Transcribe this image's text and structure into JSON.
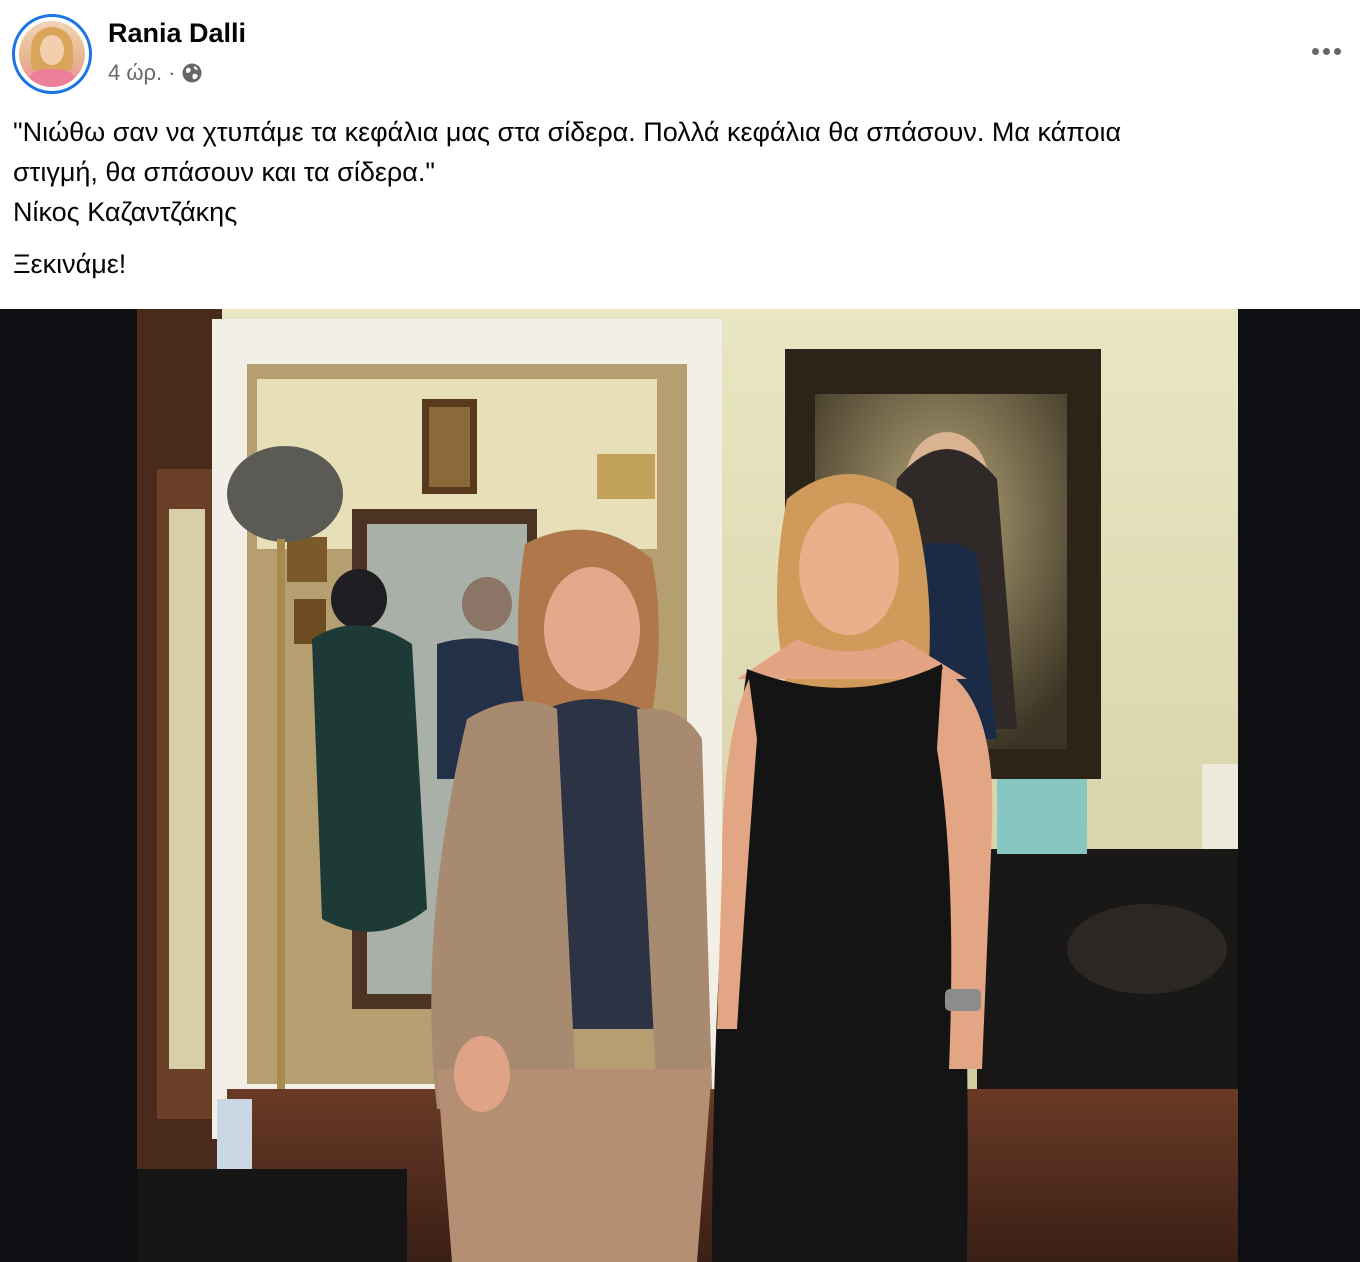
{
  "post": {
    "author": "Rania Dalli",
    "time": "4 ώρ.",
    "separator": "·",
    "privacy_icon": "globe-icon",
    "more_icon": "more-options-icon",
    "text_lines": [
      "\"Νιώθω σαν να χτυπάμε τα κεφάλια μας στα σίδερα. Πολλά κεφάλια θα σπάσουν. Μα κάποια",
      "στιγμή, θα σπάσουν και τα σίδερα.\"",
      "Νίκος Καζαντζάκης"
    ],
    "closing": "Ξεκινάμε!",
    "photo": "two-women-standing-in-room-photo"
  },
  "colors": {
    "accent": "#1b74e4",
    "text": "#050505",
    "secondary_text": "#65676b",
    "photo_backdrop": "#0d0f12"
  }
}
